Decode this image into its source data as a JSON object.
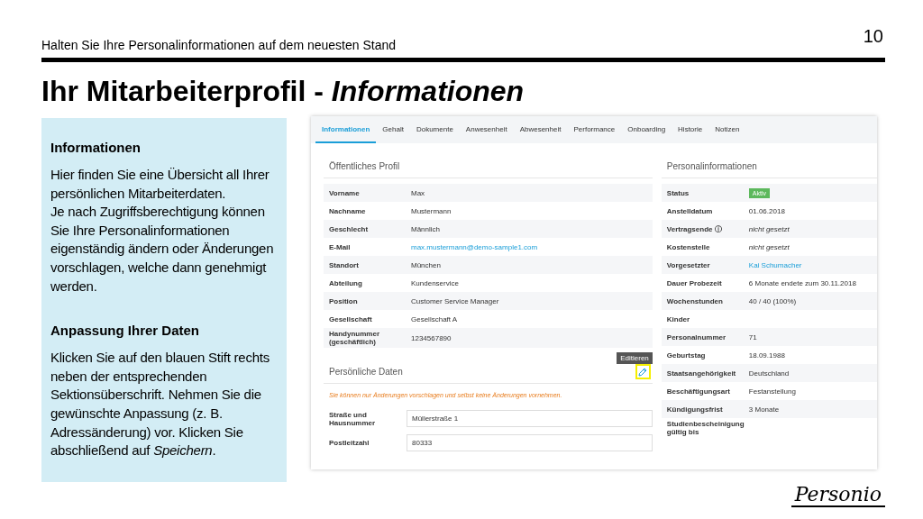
{
  "header": {
    "subtitle": "Halten Sie Ihre Personalinformationen auf dem neuesten Stand",
    "page_number": "10"
  },
  "title": "Ihr Mitarbeiterprofil - *Informationen*",
  "info_panel": {
    "sections": [
      {
        "heading": "Informationen",
        "paragraphs": [
          "Hier finden Sie eine Übersicht all Ihrer persönlichen Mitarbeiterdaten.",
          "Je nach Zugriffsberechtigung können Sie Ihre Personalinformationen eigenständig ändern oder Änderungen vorschlagen, welche dann genehmigt werden."
        ]
      },
      {
        "heading": "Anpassung Ihrer Daten",
        "paragraphs": [
          "Klicken Sie auf den blauen Stift rechts neben der entsprechenden Sektionsüberschrift. Nehmen Sie die gewünschte Anpassung (z. B. Adressänderung) vor. Klicken Sie abschließend auf *Speichern*."
        ]
      }
    ]
  },
  "app": {
    "tabs": [
      {
        "label": "Informationen",
        "selected": true
      },
      {
        "label": "Gehalt",
        "selected": false
      },
      {
        "label": "Dokumente",
        "selected": false
      },
      {
        "label": "Anwesenheit",
        "selected": false
      },
      {
        "label": "Abwesenheit",
        "selected": false
      },
      {
        "label": "Performance",
        "selected": false
      },
      {
        "label": "Onboarding",
        "selected": false
      },
      {
        "label": "Historie",
        "selected": false
      },
      {
        "label": "Notizen",
        "selected": false
      }
    ],
    "public_profile": {
      "title": "Öffentliches Profil",
      "rows": [
        {
          "label": "Vorname",
          "value": "Max",
          "kind": "text"
        },
        {
          "label": "Nachname",
          "value": "Mustermann",
          "kind": "text"
        },
        {
          "label": "Geschlecht",
          "value": "Männlich",
          "kind": "text"
        },
        {
          "label": "E-Mail",
          "value": "max.mustermann@demo-sample1.com",
          "kind": "link"
        },
        {
          "label": "Standort",
          "value": "München",
          "kind": "text"
        },
        {
          "label": "Abteilung",
          "value": "Kundenservice",
          "kind": "text"
        },
        {
          "label": "Position",
          "value": "Customer Service Manager",
          "kind": "text"
        },
        {
          "label": "Gesellschaft",
          "value": "Gesellschaft A",
          "kind": "text"
        },
        {
          "label": "Handynummer (geschäftlich)",
          "value": "1234567890",
          "kind": "text"
        }
      ]
    },
    "personal_data": {
      "title": "Persönliche Daten",
      "tooltip": "Editieren",
      "notice": "Sie können nur Änderungen vorschlagen und selbst keine Änderungen vornehmen.",
      "fields": [
        {
          "label": "Straße und Hausnummer",
          "value": "Müllerstraße 1"
        },
        {
          "label": "Postleitzahl",
          "value": "80333"
        }
      ]
    },
    "personnel_info": {
      "title": "Personalinformationen",
      "rows": [
        {
          "label": "Status",
          "value": "Aktiv",
          "kind": "badge"
        },
        {
          "label": "Anstelldatum",
          "value": "01.06.2018",
          "kind": "text"
        },
        {
          "label": "Vertragsende ⓘ",
          "value": "nicht gesetzt",
          "kind": "italic"
        },
        {
          "label": "Kostenstelle",
          "value": "nicht gesetzt",
          "kind": "italic"
        },
        {
          "label": "Vorgesetzter",
          "value": "Kai Schumacher",
          "kind": "link"
        },
        {
          "label": "Dauer Probezeit",
          "value": "6 Monate endete zum 30.11.2018",
          "kind": "text"
        },
        {
          "label": "Wochenstunden",
          "value": "40 / 40 (100%)",
          "kind": "text"
        },
        {
          "label": "Kinder"
        },
        {
          "label": "Personalnummer",
          "value": "71",
          "kind": "text"
        },
        {
          "label": "Geburtstag",
          "value": "18.09.1988",
          "kind": "text"
        },
        {
          "label": "Staatsangehörigkeit",
          "value": "Deutschland",
          "kind": "text"
        },
        {
          "label": "Beschäftigungsart",
          "value": "Festanstellung",
          "kind": "text"
        },
        {
          "label": "Kündigungsfrist",
          "value": "3 Monate",
          "kind": "text"
        },
        {
          "label": "Studienbescheinigung gültig bis"
        }
      ]
    }
  },
  "logo": "Personio"
}
